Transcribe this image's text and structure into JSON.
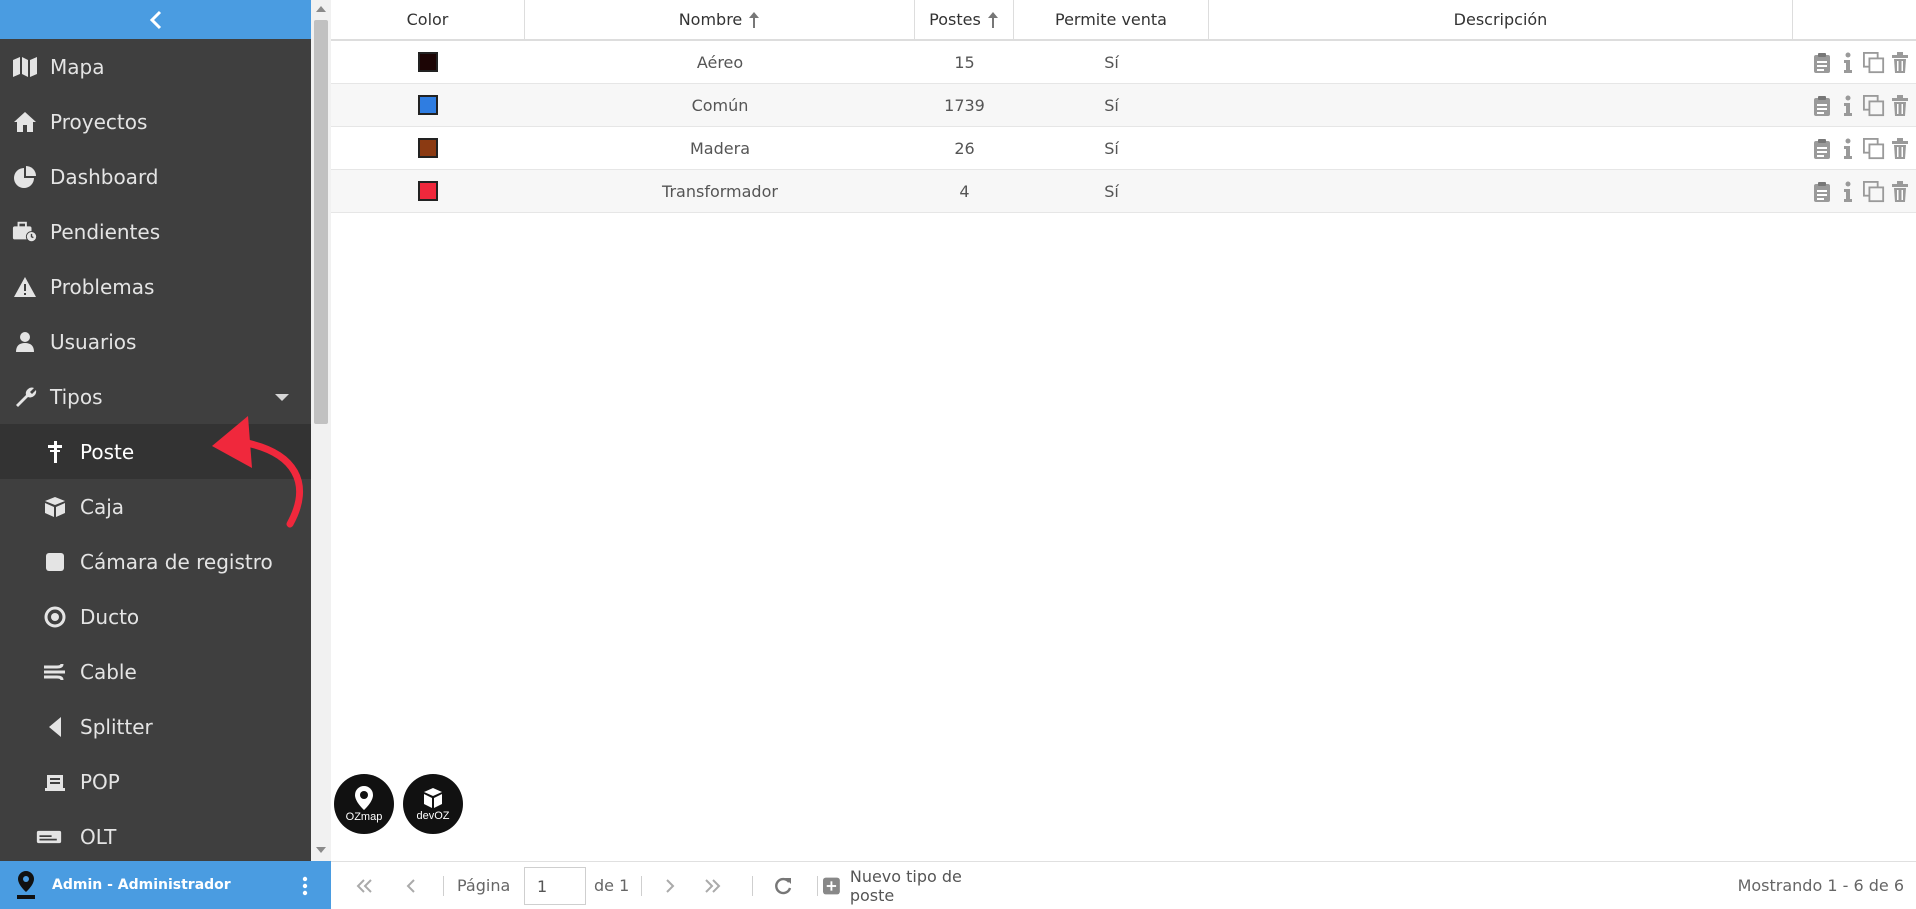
{
  "sidebar": {
    "collapse_label": "<",
    "items": [
      {
        "label": "Mapa",
        "icon": "map-icon"
      },
      {
        "label": "Proyectos",
        "icon": "home-icon"
      },
      {
        "label": "Dashboard",
        "icon": "pie-chart-icon"
      },
      {
        "label": "Pendientes",
        "icon": "briefcase-clock-icon"
      },
      {
        "label": "Problemas",
        "icon": "warning-icon"
      },
      {
        "label": "Usuarios",
        "icon": "user-icon"
      },
      {
        "label": "Tipos",
        "icon": "wrench-icon"
      },
      {
        "label": "Poste",
        "icon": "pole-icon"
      },
      {
        "label": "Caja",
        "icon": "cube-icon"
      },
      {
        "label": "Cámara de registro",
        "icon": "square-icon"
      },
      {
        "label": "Ducto",
        "icon": "target-icon"
      },
      {
        "label": "Cable",
        "icon": "cable-icon"
      },
      {
        "label": "Splitter",
        "icon": "triangle-left-icon"
      },
      {
        "label": "POP",
        "icon": "building-icon"
      },
      {
        "label": "OLT",
        "icon": "device-icon"
      }
    ],
    "active_item": "Poste",
    "user_label": "Admin - Administrador"
  },
  "table": {
    "columns": [
      "Color",
      "Nombre",
      "Postes",
      "Permite venta",
      "Descripción"
    ],
    "rows": [
      {
        "color": "#1c0505",
        "nombre": "Aéreo",
        "postes": "15",
        "venta": "Sí",
        "descripcion": ""
      },
      {
        "color": "#2f7de1",
        "nombre": "Común",
        "postes": "1739",
        "venta": "Sí",
        "descripcion": ""
      },
      {
        "color": "#8b3a12",
        "nombre": "Madera",
        "postes": "26",
        "venta": "Sí",
        "descripcion": ""
      },
      {
        "color": "#f0283c",
        "nombre": "Transformador",
        "postes": "4",
        "venta": "Sí",
        "descripcion": ""
      }
    ]
  },
  "brands": {
    "ozmap": "OZmap",
    "devoz": "devOZ"
  },
  "footer": {
    "page_label": "Página",
    "page_value": "1",
    "of_label": "de 1",
    "new_label": "Nuevo tipo de poste",
    "status": "Mostrando 1 - 6 de 6"
  },
  "colors": {
    "sidebar": "#3f3f3f",
    "accent": "#4a9ce1",
    "annotation": "#f0283c"
  }
}
